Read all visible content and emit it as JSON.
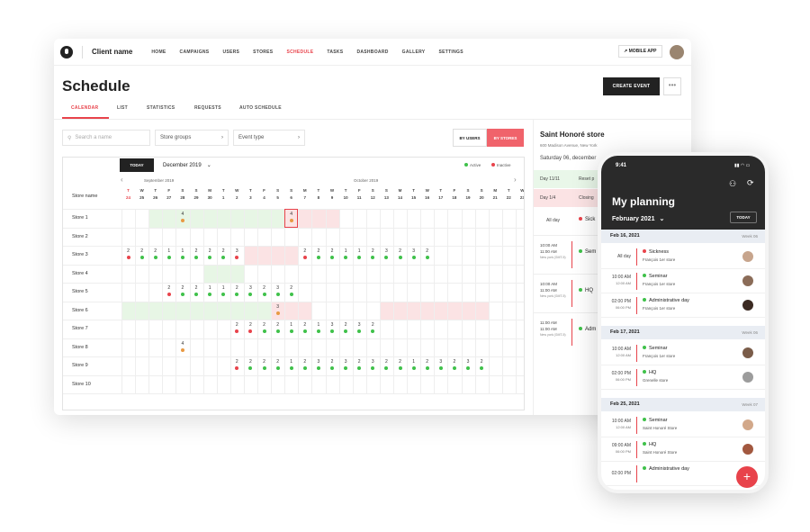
{
  "nav": {
    "client": "Client name",
    "items": [
      "HOME",
      "CAMPAIGNS",
      "USERS",
      "STORES",
      "SCHEDULE",
      "TASKS",
      "DASHBOARD",
      "GALLERY",
      "SETTINGS"
    ],
    "mobile_app": "MOBILE APP"
  },
  "page": {
    "title": "Schedule",
    "create_event": "CREATE EVENT",
    "more": "•••",
    "tabs": [
      "CALENDAR",
      "LIST",
      "STATISTICS",
      "REQUESTS",
      "AUTO SCHEDULE"
    ]
  },
  "filters": {
    "search_placeholder": "Search a name",
    "store_groups": "Store groups",
    "event_type": "Event type",
    "by_users": "BY USERS",
    "by_stores": "BY STORES"
  },
  "calendar": {
    "today": "TODAY",
    "month": "December 2019",
    "legend_active": "Active",
    "legend_inactive": "Inactive",
    "month_labels": [
      "September 2019",
      "October 2019"
    ],
    "store_name_header": "Store name",
    "weekdays": [
      "T",
      "W",
      "T",
      "F",
      "S",
      "S",
      "M",
      "T",
      "W",
      "T",
      "F",
      "S",
      "S",
      "M",
      "T",
      "W",
      "T",
      "F",
      "S",
      "S",
      "M",
      "T",
      "W",
      "T",
      "F",
      "S",
      "S",
      "M",
      "T",
      "W"
    ],
    "dates": [
      "24",
      "25",
      "26",
      "27",
      "28",
      "29",
      "30",
      "1",
      "2",
      "3",
      "4",
      "5",
      "6",
      "7",
      "8",
      "9",
      "10",
      "11",
      "12",
      "13",
      "14",
      "15",
      "16",
      "17",
      "18",
      "19",
      "20",
      "21",
      "22",
      "23"
    ],
    "stores": [
      "Store 1",
      "Store 2",
      "Store 3",
      "Store 4",
      "Store 5",
      "Store 6",
      "Store 7",
      "Store 8",
      "Store 9",
      "Store 10"
    ]
  },
  "side": {
    "store": "Saint Honoré store",
    "address": "600 Madison Avenue, New York",
    "date": "Saturday 06, december",
    "rows": [
      {
        "day": "Day 11/11",
        "ev": "Reset p"
      },
      {
        "day": "Day 1/4",
        "ev": "Closing"
      }
    ],
    "allday": "All day",
    "allday_ev": "Sick",
    "events": [
      {
        "time": "10:00 AM",
        "end": "11:00 AM",
        "tz": "New york (GMT-5)",
        "name": "Sem"
      },
      {
        "time": "10:00 AM",
        "end": "11:00 AM",
        "tz": "New york (GMT-5)",
        "name": "HQ"
      },
      {
        "time": "11:00 AM",
        "end": "11:00 AM",
        "tz": "New york (GMT-5)",
        "name": "Adm"
      }
    ]
  },
  "phone": {
    "time": "9:41",
    "title": "My planning",
    "month": "February 2021",
    "today": "TODAY",
    "days": [
      {
        "date": "Feb 16, 2021",
        "week": "Week 06",
        "events": [
          {
            "time": "All day",
            "end": "",
            "name": "Sickness",
            "store": "François 1er store",
            "color": "#e8434b"
          },
          {
            "time": "10:00 AM",
            "end": "12:00 AM",
            "name": "Seminar",
            "store": "François 1er store",
            "color": "#3fc14a"
          },
          {
            "time": "02:00 PM",
            "end": "06:00 PM",
            "name": "Administrative day",
            "store": "François 1er store",
            "color": "#3fc14a"
          }
        ]
      },
      {
        "date": "Feb 17, 2021",
        "week": "Week 06",
        "events": [
          {
            "time": "10:00 AM",
            "end": "12:00 AM",
            "name": "Seminar",
            "store": "François 1er store",
            "color": "#3fc14a"
          },
          {
            "time": "02:00 PM",
            "end": "06:00 PM",
            "name": "HQ",
            "store": "Grenelle store",
            "color": "#3fc14a"
          }
        ]
      },
      {
        "date": "Feb 25, 2021",
        "week": "Week 07",
        "events": [
          {
            "time": "10:00 AM",
            "end": "12:00 AM",
            "name": "Seminar",
            "store": "Saint Honoré Store",
            "color": "#3fc14a"
          },
          {
            "time": "09:00 AM",
            "end": "06:00 PM",
            "name": "HQ",
            "store": "Saint Honoré Store",
            "color": "#3fc14a"
          },
          {
            "time": "02:00 PM",
            "end": "",
            "name": "Administrative day",
            "store": "",
            "color": "#3fc14a"
          }
        ]
      }
    ],
    "fab": "+"
  }
}
